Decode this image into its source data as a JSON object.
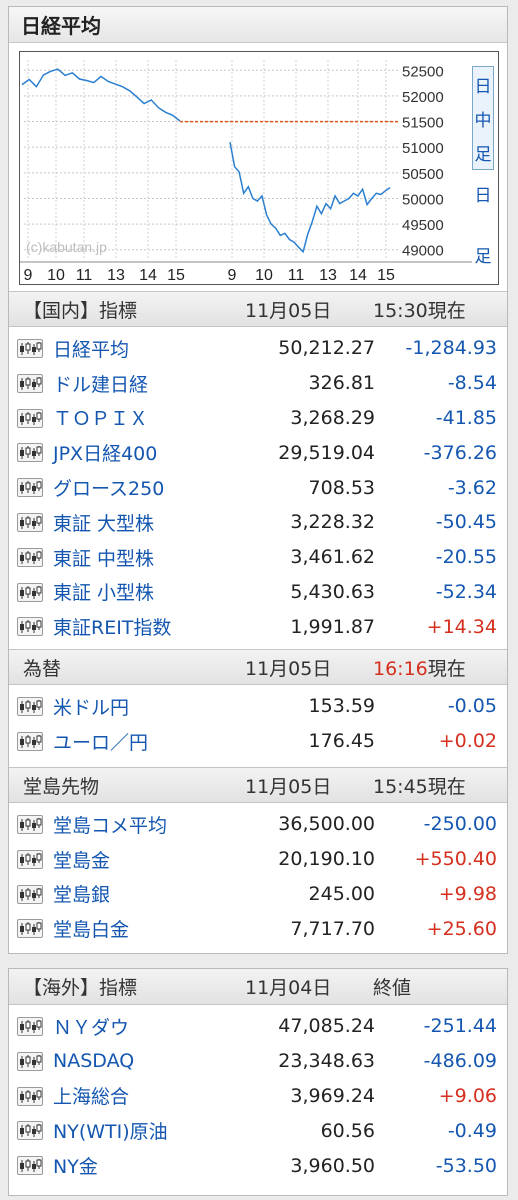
{
  "title": "日経平均",
  "chart": {
    "watermark": "(c)kabutan.jp",
    "y_ticks": [
      "52500",
      "52000",
      "51500",
      "51000",
      "50500",
      "50000",
      "49500",
      "49000"
    ],
    "x_ticks_left": [
      "9",
      "10",
      "11",
      "13",
      "14",
      "15"
    ],
    "x_ticks_right": [
      "9",
      "10",
      "11",
      "13",
      "14",
      "15"
    ],
    "tab_top": [
      "日",
      "中",
      "足"
    ],
    "tab_bottom": [
      "日",
      "",
      "足"
    ],
    "prev_close": 51497.2,
    "morning_prev_day": [
      52220,
      52320,
      52180,
      52410,
      52480,
      52520,
      52400,
      52450,
      52330,
      52300,
      52260,
      52380,
      52280,
      52230,
      52180,
      52100,
      51980,
      51850,
      51920,
      51770,
      51680,
      51620,
      51510
    ],
    "today": [
      51100,
      50620,
      50520,
      50100,
      50230,
      50000,
      49950,
      50050,
      49680,
      49500,
      49420,
      49280,
      49320,
      49200,
      49150,
      49050,
      48960,
      49300,
      49550,
      49850,
      49700,
      49900,
      49800,
      50050,
      49900,
      49950,
      50000,
      50100,
      50050,
      50180,
      49880,
      50000,
      50100,
      50080,
      50150,
      50212
    ]
  },
  "domestic": {
    "name": "【国内】指標",
    "date": "11月05日",
    "time": "15:30現在",
    "rows": [
      {
        "name": "日経平均",
        "value": "50,212.27",
        "change": "-1,284.93",
        "dir": "neg"
      },
      {
        "name": "ドル建日経",
        "value": "326.81",
        "change": "-8.54",
        "dir": "neg"
      },
      {
        "name": "ＴＯＰＩＸ",
        "value": "3,268.29",
        "change": "-41.85",
        "dir": "neg"
      },
      {
        "name": "JPX日経400",
        "value": "29,519.04",
        "change": "-376.26",
        "dir": "neg"
      },
      {
        "name": "グロース250",
        "value": "708.53",
        "change": "-3.62",
        "dir": "neg"
      },
      {
        "name": "東証 大型株",
        "value": "3,228.32",
        "change": "-50.45",
        "dir": "neg"
      },
      {
        "name": "東証 中型株",
        "value": "3,461.62",
        "change": "-20.55",
        "dir": "neg"
      },
      {
        "name": "東証 小型株",
        "value": "5,430.63",
        "change": "-52.34",
        "dir": "neg"
      },
      {
        "name": "東証REIT指数",
        "value": "1,991.87",
        "change": "+14.34",
        "dir": "pos"
      }
    ]
  },
  "fx": {
    "name": "為替",
    "date": "11月05日",
    "time_red": "16:16",
    "time_suffix": "現在",
    "rows": [
      {
        "name": "米ドル円",
        "value": "153.59",
        "change": "-0.05",
        "dir": "neg"
      },
      {
        "name": "ユーロ／円",
        "value": "176.45",
        "change": "+0.02",
        "dir": "pos"
      }
    ]
  },
  "dojima": {
    "name": "堂島先物",
    "date": "11月05日",
    "time": "15:45現在",
    "rows": [
      {
        "name": "堂島コメ平均",
        "value": "36,500.00",
        "change": "-250.00",
        "dir": "neg"
      },
      {
        "name": "堂島金",
        "value": "20,190.10",
        "change": "+550.40",
        "dir": "pos"
      },
      {
        "name": "堂島銀",
        "value": "245.00",
        "change": "+9.98",
        "dir": "pos"
      },
      {
        "name": "堂島白金",
        "value": "7,717.70",
        "change": "+25.60",
        "dir": "pos"
      }
    ]
  },
  "overseas": {
    "name": "【海外】指標",
    "date": "11月04日",
    "time": "終値",
    "rows": [
      {
        "name": "ＮＹダウ",
        "value": "47,085.24",
        "change": "-251.44",
        "dir": "neg"
      },
      {
        "name": "NASDAQ",
        "value": "23,348.63",
        "change": "-486.09",
        "dir": "neg"
      },
      {
        "name": "上海総合",
        "value": "3,969.24",
        "change": "+9.06",
        "dir": "pos"
      },
      {
        "name": "NY(WTI)原油",
        "value": "60.56",
        "change": "-0.49",
        "dir": "neg"
      },
      {
        "name": "NY金",
        "value": "3,960.50",
        "change": "-53.50",
        "dir": "neg"
      }
    ]
  },
  "colors": {
    "negative": "#1557b0",
    "positive": "#d52f1e",
    "line": "#2a7fd0",
    "prev_close_line": "#e0521f"
  }
}
